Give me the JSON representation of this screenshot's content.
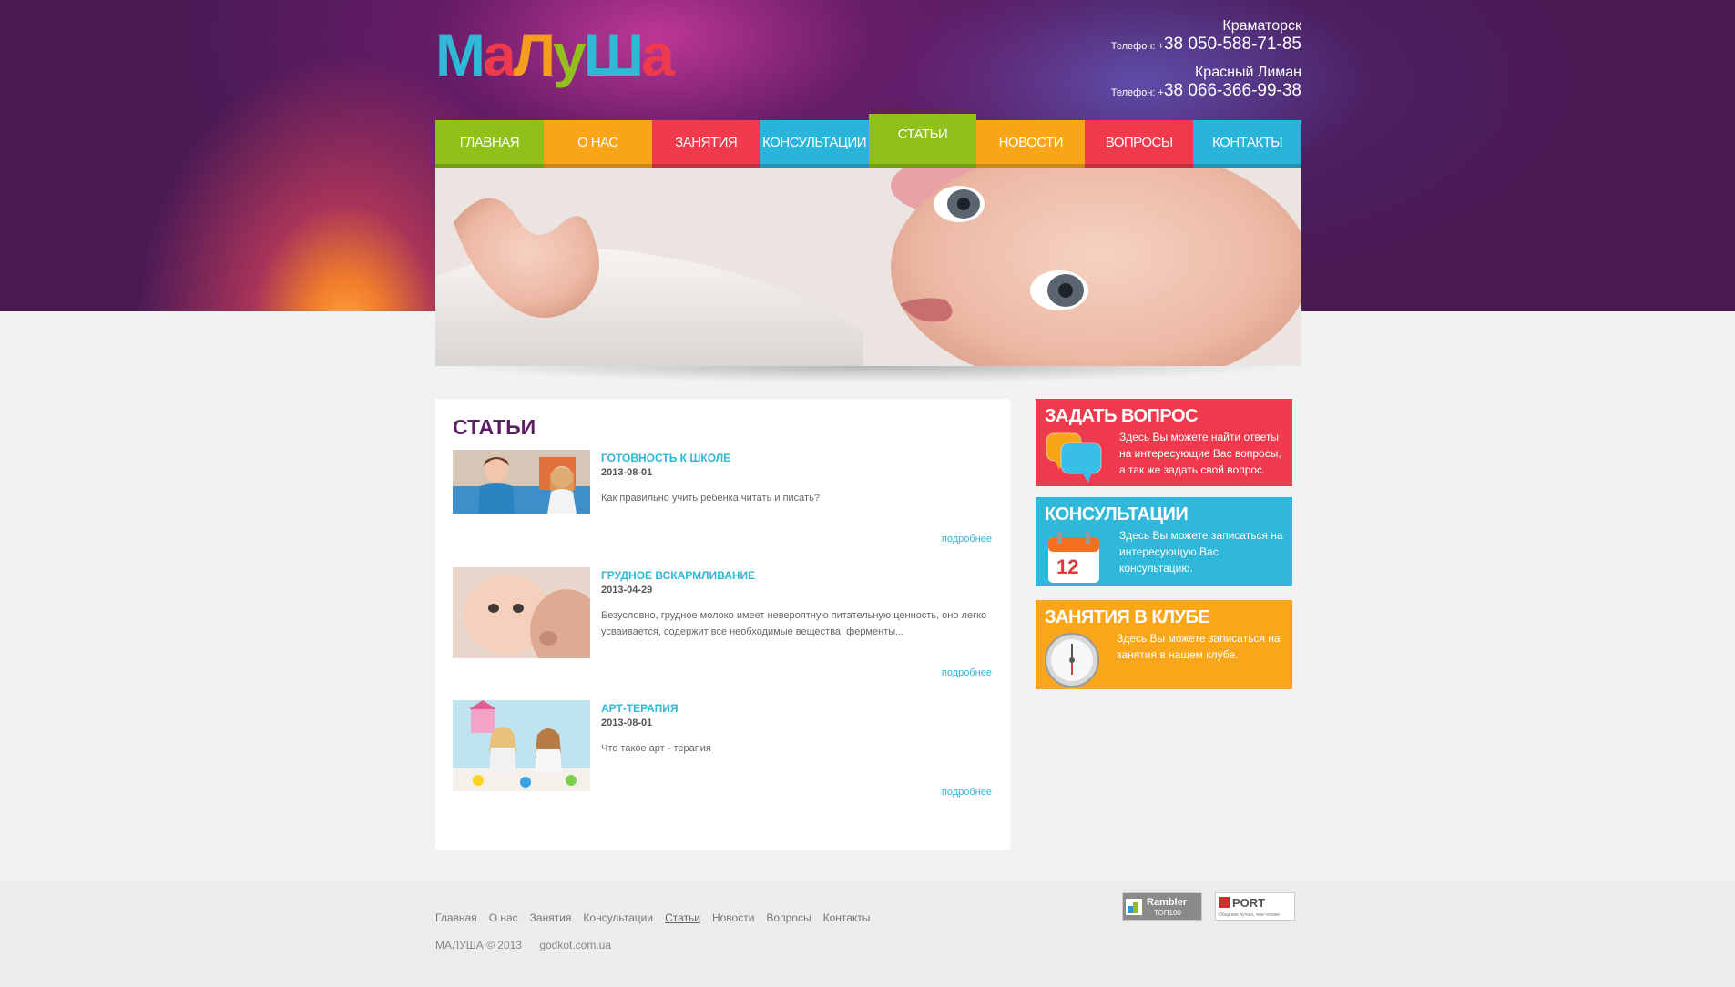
{
  "logo": {
    "letters": [
      {
        "ch": "М",
        "color": "#2fb9d6"
      },
      {
        "ch": "а",
        "color": "#ef3a4d"
      },
      {
        "ch": "Л",
        "color": "#f69d1d"
      },
      {
        "ch": "у",
        "color": "#93c01f"
      },
      {
        "ch": "Ш",
        "color": "#2fb9d6"
      },
      {
        "ch": "а",
        "color": "#ef3a4d"
      }
    ]
  },
  "contacts": [
    {
      "city": "Краматорск",
      "label": "Телефон: +",
      "number": "38 050-588-71-85"
    },
    {
      "city": "Красный Лиман",
      "label": "Телефон: +",
      "number": "38 066-366-99-38"
    }
  ],
  "nav": [
    {
      "label": "Главная",
      "color": "#8fc11a",
      "active": false
    },
    {
      "label": "О нас",
      "color": "#f8a51a",
      "active": false
    },
    {
      "label": "Занятия",
      "color": "#ef3a4b",
      "active": false
    },
    {
      "label": "Консультации",
      "color": "#2bb4da",
      "active": false
    },
    {
      "label": "Статьи",
      "color": "#8fc11a",
      "active": true
    },
    {
      "label": "Новости",
      "color": "#f8a51a",
      "active": false
    },
    {
      "label": "Вопросы",
      "color": "#ef3a4b",
      "active": false
    },
    {
      "label": "Контакты",
      "color": "#2bb4da",
      "active": false
    }
  ],
  "content": {
    "heading": "СТАТЬИ",
    "more_label": "подробнее",
    "articles": [
      {
        "title": "Готовность к школе",
        "date": "2013-08-01",
        "desc": "Как правильно учить ребенка читать и писать?"
      },
      {
        "title": "Грудное вскармливание",
        "date": "2013-04-29",
        "desc": "Безусловно, грудное молоко имеет невероятную питательную ценность, оно легко усваивается, содержит все необходимые вещества, ферменты..."
      },
      {
        "title": "Арт-терапия",
        "date": "2013-08-01",
        "desc": "Что такое арт - терапия"
      }
    ]
  },
  "sidebar": [
    {
      "title": "Задать вопрос",
      "desc": "Здесь Вы можете найти ответы на интересующие Вас вопросы, а так же задать свой вопрос.",
      "color": "#ee3a4c",
      "icon": "chat-bubbles-icon"
    },
    {
      "title": "Консультации",
      "desc": "Здесь Вы можете записаться на интересующую Вас консультацию.",
      "color": "#2fb8da",
      "icon": "calendar-icon",
      "calendar_day": "12"
    },
    {
      "title": "Занятия в клубе",
      "desc": "Здесь Вы можете записаться на занятия в нашем клубе.",
      "color": "#faa61a",
      "icon": "clock-icon"
    }
  ],
  "footer": {
    "links": [
      "Главная",
      "О нас",
      "Занятия",
      "Консультации",
      "Статьи",
      "Новости",
      "Вопросы",
      "Контакты"
    ],
    "current": "Статьи",
    "copyright": "МАЛУША  © 2013",
    "site": "godkot.com.ua",
    "counters": [
      {
        "name": "Rambler",
        "sub": "ТОП100"
      },
      {
        "name": "PORT",
        "sub": "Общение лучше, чем чтение"
      }
    ]
  }
}
